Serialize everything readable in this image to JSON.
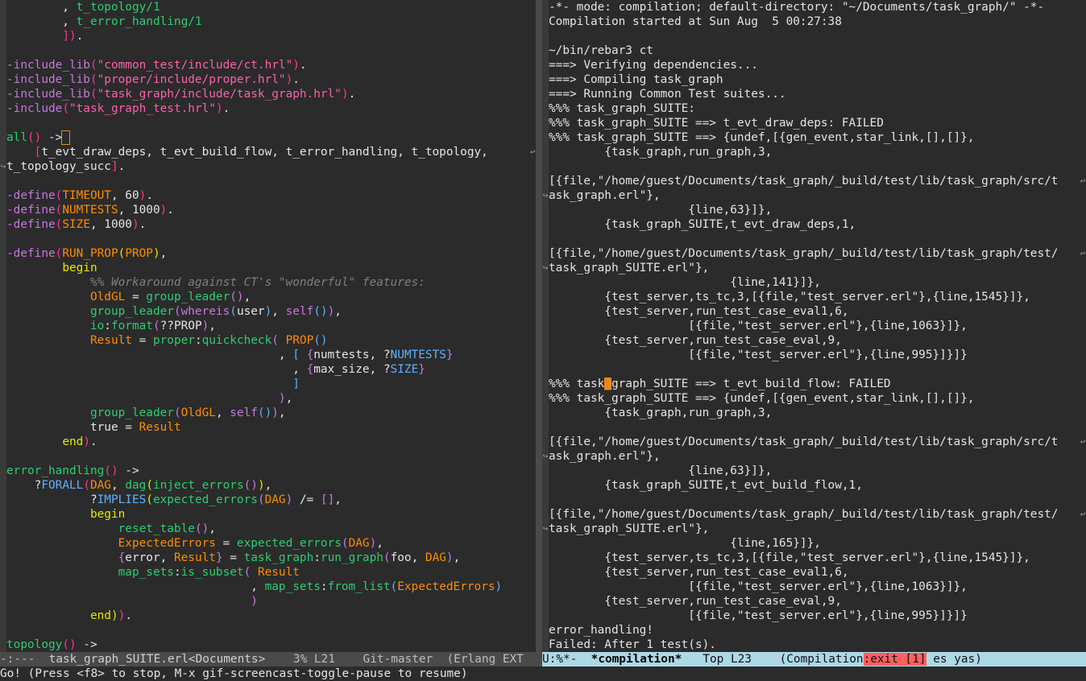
{
  "left_buffer": {
    "lines": [
      [
        [
          "        , ",
          ""
        ],
        [
          "t_topology/1",
          "fn"
        ]
      ],
      [
        [
          "        , ",
          ""
        ],
        [
          "t_error_handling/1",
          "fn"
        ]
      ],
      [
        [
          "        ",
          ""
        ],
        [
          "])",
          "p2"
        ],
        [
          ".",
          ""
        ]
      ],
      [],
      [
        [
          "-include_lib",
          "kw"
        ],
        [
          "(",
          "p2"
        ],
        [
          "\"common_test/include/ct.hrl\"",
          "str"
        ],
        [
          ")",
          "p2"
        ],
        [
          ".",
          ""
        ]
      ],
      [
        [
          "-include_lib",
          "kw"
        ],
        [
          "(",
          "p2"
        ],
        [
          "\"proper/include/proper.hrl\"",
          "str"
        ],
        [
          ")",
          "p2"
        ],
        [
          ".",
          ""
        ]
      ],
      [
        [
          "-include_lib",
          "kw"
        ],
        [
          "(",
          "p2"
        ],
        [
          "\"task_graph/include/task_graph.hrl\"",
          "str"
        ],
        [
          ")",
          "p2"
        ],
        [
          ".",
          ""
        ]
      ],
      [
        [
          "-include",
          "kw"
        ],
        [
          "(",
          "p2"
        ],
        [
          "\"task_graph_test.hrl\"",
          "str"
        ],
        [
          ")",
          "p2"
        ],
        [
          ".",
          ""
        ]
      ],
      [],
      [
        [
          "all",
          "fn"
        ],
        [
          "()",
          "p2"
        ],
        [
          " ->",
          ""
        ],
        [
          " ",
          "cursor-box"
        ]
      ],
      [
        [
          "    ",
          ""
        ],
        [
          "[",
          "p2"
        ],
        [
          "t_evt_draw_deps, t_evt_build_flow, t_error_handling, t_topology, ",
          ""
        ]
      ],
      [
        [
          "t_topology_succ",
          ""
        ],
        [
          "]",
          "p2"
        ],
        [
          ".",
          ""
        ]
      ],
      [],
      [
        [
          "-define",
          "kw"
        ],
        [
          "(",
          "p2"
        ],
        [
          "TIMEOUT",
          "mac"
        ],
        [
          ", 60",
          ""
        ],
        [
          ")",
          "p2"
        ],
        [
          ".",
          ""
        ]
      ],
      [
        [
          "-define",
          "kw"
        ],
        [
          "(",
          "p2"
        ],
        [
          "NUMTESTS",
          "mac"
        ],
        [
          ", 1000",
          ""
        ],
        [
          ")",
          "p2"
        ],
        [
          ".",
          ""
        ]
      ],
      [
        [
          "-define",
          "kw"
        ],
        [
          "(",
          "p2"
        ],
        [
          "SIZE",
          "mac"
        ],
        [
          ", 1000",
          ""
        ],
        [
          ")",
          "p2"
        ],
        [
          ".",
          ""
        ]
      ],
      [],
      [
        [
          "-define",
          "kw"
        ],
        [
          "(",
          "p2"
        ],
        [
          "RUN_PROP",
          "mac"
        ],
        [
          "(",
          "p1"
        ],
        [
          "PROP",
          "var"
        ],
        [
          ")",
          "p1"
        ],
        [
          ",",
          ""
        ]
      ],
      [
        [
          "        ",
          ""
        ],
        [
          "begin",
          "p1"
        ]
      ],
      [
        [
          "            ",
          ""
        ],
        [
          "%% Workaround against CT's \"wonderful\" features:",
          "cmt"
        ]
      ],
      [
        [
          "            ",
          ""
        ],
        [
          "OldGL",
          "var"
        ],
        [
          " = ",
          ""
        ],
        [
          "group_leader",
          "fn"
        ],
        [
          "()",
          "p3"
        ],
        [
          ",",
          ""
        ]
      ],
      [
        [
          "            ",
          ""
        ],
        [
          "group_leader",
          "fn"
        ],
        [
          "(",
          "p3"
        ],
        [
          "whereis",
          "bi"
        ],
        [
          "(",
          "mb"
        ],
        [
          "user",
          ""
        ],
        [
          ")",
          "mb"
        ],
        [
          ", ",
          ""
        ],
        [
          "self",
          "bi"
        ],
        [
          "()",
          "mb"
        ],
        [
          ")",
          "p3"
        ],
        [
          ",",
          ""
        ]
      ],
      [
        [
          "            ",
          ""
        ],
        [
          "io",
          "mod"
        ],
        [
          ":",
          ""
        ],
        [
          "format",
          "fn"
        ],
        [
          "(",
          "p3"
        ],
        [
          "??PROP",
          ""
        ],
        [
          ")",
          "p3"
        ],
        [
          ",",
          ""
        ]
      ],
      [
        [
          "            ",
          ""
        ],
        [
          "Result",
          "var"
        ],
        [
          " = ",
          ""
        ],
        [
          "proper",
          "mod"
        ],
        [
          ":",
          ""
        ],
        [
          "quickcheck",
          "fn"
        ],
        [
          "( ",
          "p3"
        ],
        [
          "PROP",
          "var"
        ],
        [
          "()",
          "mb"
        ]
      ],
      [
        [
          "                                       , ",
          ""
        ],
        [
          "[",
          "mb"
        ],
        [
          " {",
          "p3"
        ],
        [
          "numtests, ?",
          ""
        ],
        [
          "NUMTESTS",
          "mb"
        ],
        [
          "}",
          "p3"
        ]
      ],
      [
        [
          "                                         , ",
          ""
        ],
        [
          "{",
          "p3"
        ],
        [
          "max_size, ?",
          ""
        ],
        [
          "SIZE",
          "mb"
        ],
        [
          "}",
          "p3"
        ]
      ],
      [
        [
          "                                         ",
          ""
        ],
        [
          "]",
          "mb"
        ]
      ],
      [
        [
          "                                       ",
          ""
        ],
        [
          ")",
          "p3"
        ],
        [
          ",",
          ""
        ]
      ],
      [
        [
          "            ",
          ""
        ],
        [
          "group_leader",
          "fn"
        ],
        [
          "(",
          "p3"
        ],
        [
          "OldGL",
          "var"
        ],
        [
          ", ",
          ""
        ],
        [
          "self",
          "bi"
        ],
        [
          "()",
          "mb"
        ],
        [
          ")",
          "p3"
        ],
        [
          ",",
          ""
        ]
      ],
      [
        [
          "            true = ",
          ""
        ],
        [
          "Result",
          "var"
        ]
      ],
      [
        [
          "        ",
          ""
        ],
        [
          "end",
          "p1"
        ],
        [
          ")",
          "p2"
        ],
        [
          ".",
          ""
        ]
      ],
      [],
      [
        [
          "error_handling",
          "fn"
        ],
        [
          "()",
          "p2"
        ],
        [
          " ->",
          ""
        ]
      ],
      [
        [
          "    ?",
          ""
        ],
        [
          "FORALL",
          "mb"
        ],
        [
          "(",
          "p2"
        ],
        [
          "DAG",
          "var"
        ],
        [
          ", ",
          ""
        ],
        [
          "dag",
          "fn"
        ],
        [
          "(",
          "p1"
        ],
        [
          "inject_errors",
          "fn"
        ],
        [
          "()",
          "p3"
        ],
        [
          ")",
          "p1"
        ],
        [
          ",",
          ""
        ]
      ],
      [
        [
          "            ?",
          ""
        ],
        [
          "IMPLIES",
          "mb"
        ],
        [
          "(",
          "p1"
        ],
        [
          "expected_errors",
          "fn"
        ],
        [
          "(",
          "p3"
        ],
        [
          "DAG",
          "var"
        ],
        [
          ")",
          "p3"
        ],
        [
          " /= ",
          ""
        ],
        [
          "[]",
          "p3"
        ],
        [
          ",",
          ""
        ]
      ],
      [
        [
          "            ",
          ""
        ],
        [
          "begin",
          "p1"
        ]
      ],
      [
        [
          "                ",
          ""
        ],
        [
          "reset_table",
          "fn"
        ],
        [
          "()",
          "p3"
        ],
        [
          ",",
          ""
        ]
      ],
      [
        [
          "                ",
          ""
        ],
        [
          "ExpectedErrors",
          "var"
        ],
        [
          " = ",
          ""
        ],
        [
          "expected_errors",
          "fn"
        ],
        [
          "(",
          "p3"
        ],
        [
          "DAG",
          "var"
        ],
        [
          ")",
          "p3"
        ],
        [
          ",",
          ""
        ]
      ],
      [
        [
          "                ",
          ""
        ],
        [
          "{",
          "p3"
        ],
        [
          "error, ",
          ""
        ],
        [
          "Result",
          "var"
        ],
        [
          "}",
          "p3"
        ],
        [
          " = ",
          ""
        ],
        [
          "task_graph",
          "mod"
        ],
        [
          ":",
          ""
        ],
        [
          "run_graph",
          "fn"
        ],
        [
          "(",
          "p3"
        ],
        [
          "foo, ",
          ""
        ],
        [
          "DAG",
          "var"
        ],
        [
          ")",
          "p3"
        ],
        [
          ",",
          ""
        ]
      ],
      [
        [
          "                ",
          ""
        ],
        [
          "map_sets",
          "mod"
        ],
        [
          ":",
          ""
        ],
        [
          "is_subset",
          "fn"
        ],
        [
          "( ",
          "p3"
        ],
        [
          "Result",
          "var"
        ]
      ],
      [
        [
          "                                   , ",
          ""
        ],
        [
          "map_sets",
          "mod"
        ],
        [
          ":",
          ""
        ],
        [
          "from_list",
          "fn"
        ],
        [
          "(",
          "mb"
        ],
        [
          "ExpectedErrors",
          "var"
        ],
        [
          ")",
          "mb"
        ]
      ],
      [
        [
          "                                   ",
          ""
        ],
        [
          ")",
          "p3"
        ]
      ],
      [
        [
          "            ",
          ""
        ],
        [
          "end",
          "p1"
        ],
        [
          ")",
          "p1"
        ],
        [
          ")",
          "p2"
        ],
        [
          ".",
          ""
        ]
      ],
      [],
      [
        [
          "topology",
          "fn"
        ],
        [
          "()",
          "p2"
        ],
        [
          " ->",
          ""
        ]
      ]
    ],
    "continuation_lines": [
      10,
      11
    ]
  },
  "right_buffer": {
    "lines": [
      [
        [
          "-*- mode: compilation; default-directory: \"~/Documents/task_graph/\" -*-",
          ""
        ]
      ],
      [
        [
          "Compilation started at Sun Aug  5 00:27:38",
          ""
        ]
      ],
      [],
      [
        [
          "~/bin/rebar3 ct",
          ""
        ]
      ],
      [
        [
          "===> Verifying dependencies...",
          ""
        ]
      ],
      [
        [
          "===> Compiling task_graph",
          ""
        ]
      ],
      [
        [
          "===> Running Common Test suites...",
          ""
        ]
      ],
      [
        [
          "%%% task_graph_SUITE:",
          ""
        ]
      ],
      [
        [
          "%%% task_graph_SUITE ==> t_evt_draw_deps: FAILED",
          ""
        ]
      ],
      [
        [
          "%%% task_graph_SUITE ==> {undef,[{gen_event,star_link,[],[]},",
          ""
        ]
      ],
      [
        [
          "        {task_graph,run_graph,3,",
          ""
        ]
      ],
      [],
      [
        [
          "[{file,\"/home/guest/Documents/task_graph/_build/test/lib/task_graph/src/t",
          ""
        ]
      ],
      [
        [
          "ask_graph.erl\"},",
          ""
        ]
      ],
      [
        [
          "                    {line,63}]},",
          ""
        ]
      ],
      [
        [
          "        {task_graph_SUITE,t_evt_draw_deps,1,",
          ""
        ]
      ],
      [],
      [
        [
          "[{file,\"/home/guest/Documents/task_graph/_build/test/lib/task_graph/test/",
          ""
        ]
      ],
      [
        [
          "task_graph_SUITE.erl\"},",
          ""
        ]
      ],
      [
        [
          "                          {line,141}]},",
          ""
        ]
      ],
      [
        [
          "        {test_server,ts_tc,3,[{file,\"test_server.erl\"},{line,1545}]},",
          ""
        ]
      ],
      [
        [
          "        {test_server,run_test_case_eval1,6,",
          ""
        ]
      ],
      [
        [
          "                    [{file,\"test_server.erl\"},{line,1063}]},",
          ""
        ]
      ],
      [
        [
          "        {test_server,run_test_case_eval,9,",
          ""
        ]
      ],
      [
        [
          "                    [{file,\"test_server.erl\"},{line,995}]}]}",
          ""
        ]
      ],
      [],
      [
        [
          "%%% task",
          ""
        ],
        [
          "_",
          "cursor"
        ],
        [
          "graph_SUITE ==> t_evt_build_flow: FAILED",
          ""
        ]
      ],
      [
        [
          "%%% task_graph_SUITE ==> {undef,[{gen_event,star_link,[],[]},",
          ""
        ]
      ],
      [
        [
          "        {task_graph,run_graph,3,",
          ""
        ]
      ],
      [],
      [
        [
          "[{file,\"/home/guest/Documents/task_graph/_build/test/lib/task_graph/src/t",
          ""
        ]
      ],
      [
        [
          "ask_graph.erl\"},",
          ""
        ]
      ],
      [
        [
          "                    {line,63}]},",
          ""
        ]
      ],
      [
        [
          "        {task_graph_SUITE,t_evt_build_flow,1,",
          ""
        ]
      ],
      [],
      [
        [
          "[{file,\"/home/guest/Documents/task_graph/_build/test/lib/task_graph/test/",
          ""
        ]
      ],
      [
        [
          "task_graph_SUITE.erl\"},",
          ""
        ]
      ],
      [
        [
          "                          {line,165}]},",
          ""
        ]
      ],
      [
        [
          "        {test_server,ts_tc,3,[{file,\"test_server.erl\"},{line,1545}]},",
          ""
        ]
      ],
      [
        [
          "        {test_server,run_test_case_eval1,6,",
          ""
        ]
      ],
      [
        [
          "                    [{file,\"test_server.erl\"},{line,1063}]},",
          ""
        ]
      ],
      [
        [
          "        {test_server,run_test_case_eval,9,",
          ""
        ]
      ],
      [
        [
          "                    [{file,\"test_server.erl\"},{line,995}]}]}",
          ""
        ]
      ],
      [
        [
          "error_handling!",
          ""
        ]
      ],
      [
        [
          "Failed",
          ""
        ],
        [
          ": After 1 test(s).",
          ""
        ]
      ]
    ],
    "wrap_starts": [
      12,
      17,
      30,
      35
    ]
  },
  "left_modeline": {
    "state": "-:---  ",
    "buffer": "task_graph_SUITE.erl<Documents>",
    "position": "    3% L21    ",
    "vc": "Git-master  ",
    "mode": "(Erlang EXT"
  },
  "right_modeline": {
    "state": "U:%*-  ",
    "buffer": "*compilation*",
    "position": "   Top L23    ",
    "mode_prefix": "(Compilation",
    "exit": ":exit [1]",
    "mode_suffix": " es yas)"
  },
  "echo_area": "Go! (Press <f8> to stop, M-x gif-screencast-toggle-pause to resume)",
  "colors": {
    "background": "#2b2b2b",
    "active_modeline": "#add8e6",
    "inactive_modeline": "#4a4a4a",
    "exit_badge": "#ff5f5f"
  },
  "icons": {
    "continuation": "continuation-arrow-icon"
  }
}
